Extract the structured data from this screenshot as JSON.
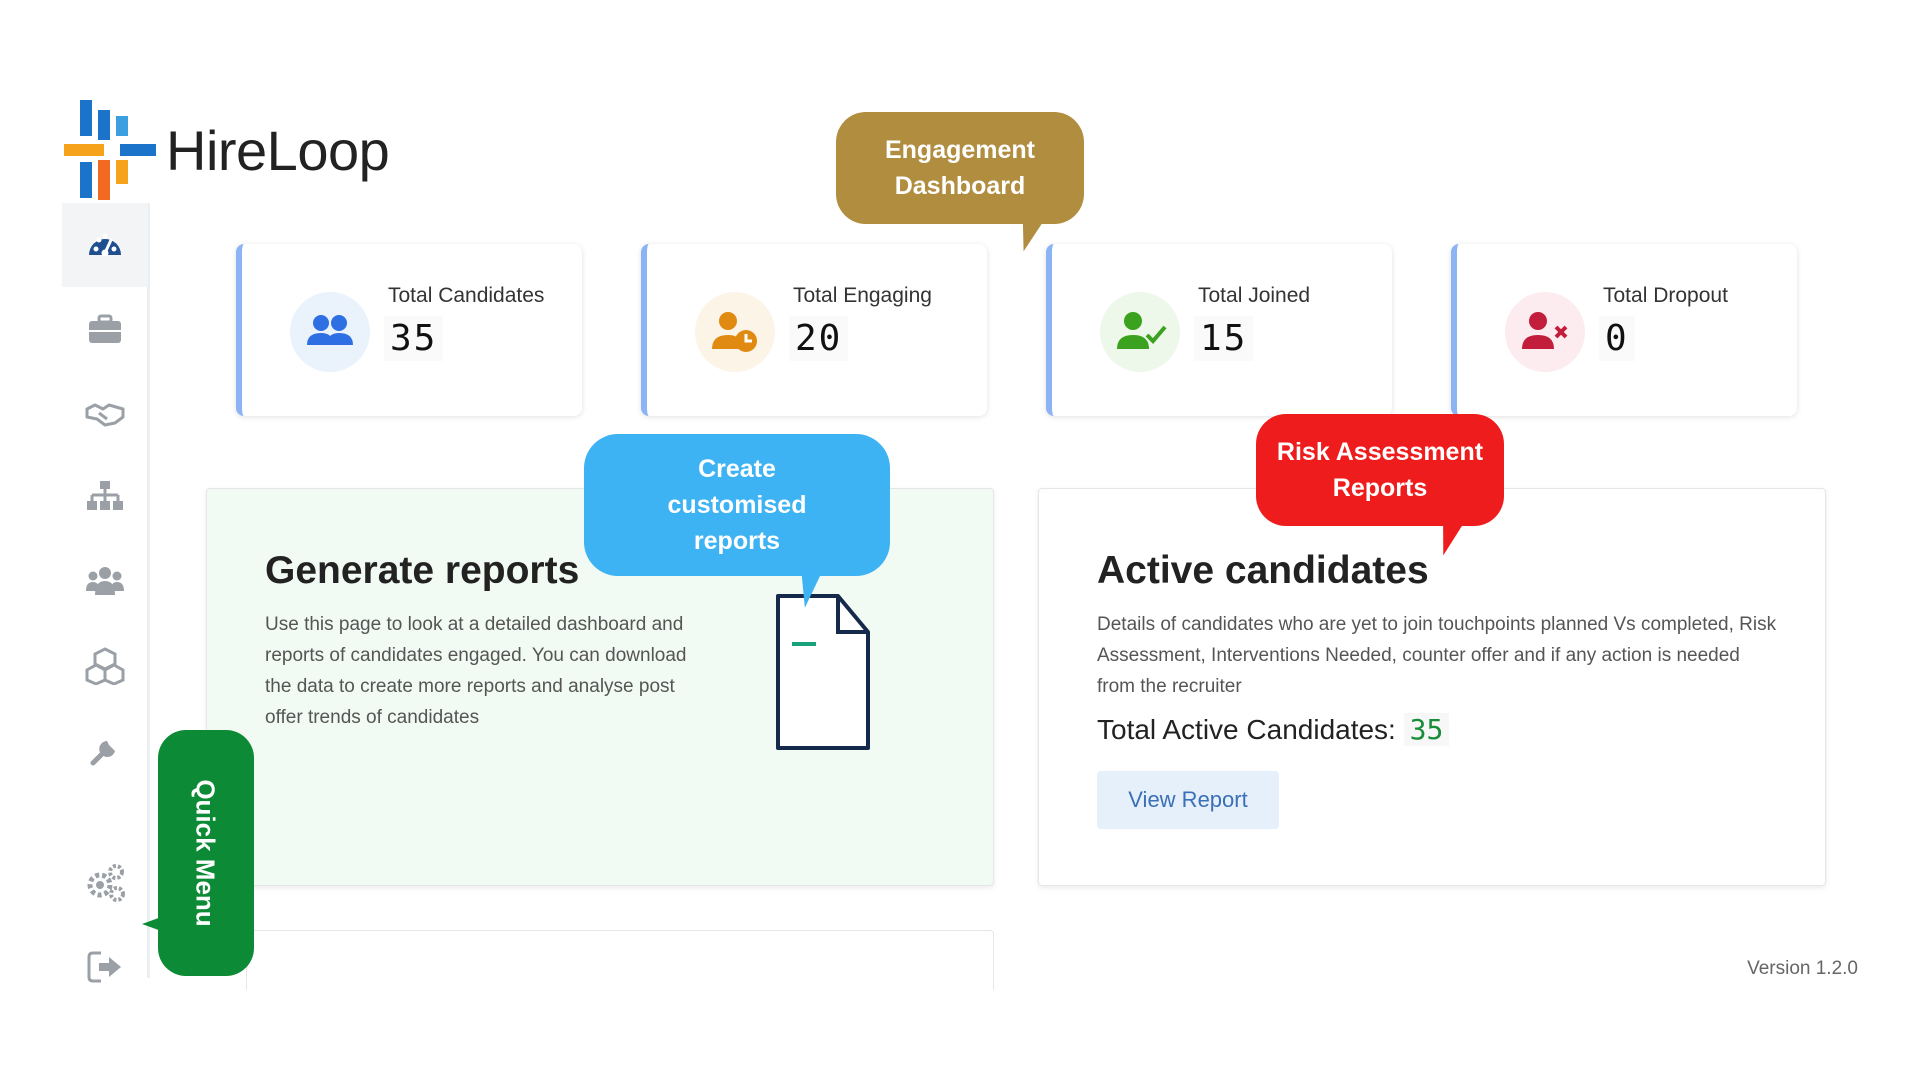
{
  "app": {
    "name": "HireLoop"
  },
  "sidebar": {
    "items": [
      {
        "icon": "dashboard-icon",
        "active": true
      },
      {
        "icon": "briefcase-icon",
        "active": false
      },
      {
        "icon": "handshake-icon",
        "active": false
      },
      {
        "icon": "org-chart-icon",
        "active": false
      },
      {
        "icon": "users-group-icon",
        "active": false
      },
      {
        "icon": "boxes-icon",
        "active": false
      },
      {
        "icon": "wrench-icon",
        "active": false
      },
      {
        "icon": "gears-icon",
        "active": false
      },
      {
        "icon": "sign-out-icon",
        "active": false
      }
    ]
  },
  "stats": [
    {
      "label": "Total Candidates",
      "value": "35",
      "icon": "users-icon",
      "color": "#2f6fe4",
      "bg": "#eaf2fc"
    },
    {
      "label": "Total Engaging",
      "value": "20",
      "icon": "user-clock-icon",
      "color": "#e08a12",
      "bg": "#fdf4e8"
    },
    {
      "label": "Total Joined",
      "value": "15",
      "icon": "user-check-icon",
      "color": "#3aa21e",
      "bg": "#eef8ea"
    },
    {
      "label": "Total Dropout",
      "value": "0",
      "icon": "user-times-icon",
      "color": "#c21d3b",
      "bg": "#fcebef"
    }
  ],
  "reports_panel": {
    "title": "Generate reports",
    "description": "Use this page to look at a detailed dashboard and reports of candidates engaged. You can download the data to create more reports and analyse post offer trends of candidates"
  },
  "active_panel": {
    "title": "Active candidates",
    "description": "Details of candidates who are yet to join touchpoints planned Vs completed, Risk Assessment, Interventions Needed, counter offer and if any action is needed from the recruiter",
    "total_label": "Total Active Candidates:",
    "total_value": "35",
    "button_label": "View Report"
  },
  "version": "Version 1.2.0",
  "callouts": {
    "engagement": "Engagement Dashboard",
    "create": "Create customised reports",
    "risk": "Risk Assessment Reports",
    "quick_menu": "Quick Menu"
  },
  "colors": {
    "engagement": "#b08d3f",
    "create": "#3db3f4",
    "risk": "#ee1c1c",
    "quick_menu": "#0c8a35",
    "card_accent": "#8cb4f5"
  }
}
